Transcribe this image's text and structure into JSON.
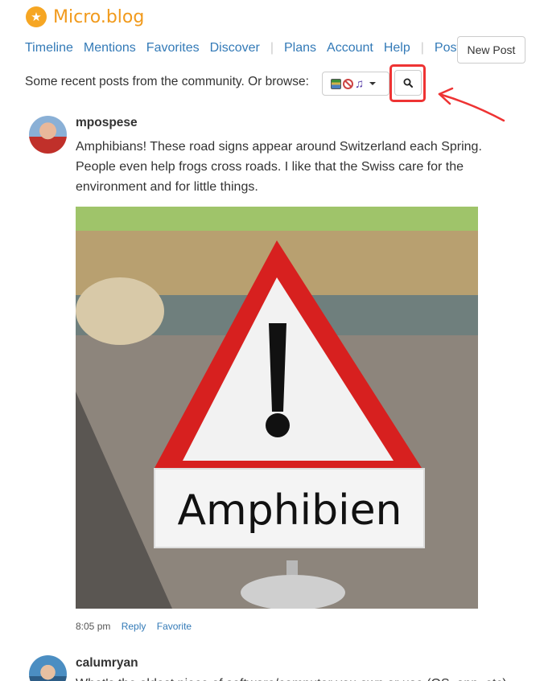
{
  "brand": {
    "name": "Micro.blog",
    "logo_icon": "star-icon",
    "accent": "#f19a1c"
  },
  "nav": {
    "items": [
      "Timeline",
      "Mentions",
      "Favorites",
      "Discover"
    ],
    "items_right": [
      "Plans",
      "Account",
      "Help"
    ],
    "items_last": [
      "Posts"
    ],
    "new_post_label": "New Post"
  },
  "browse": {
    "text": "Some recent posts from the community. Or browse:",
    "dropdown_icons": [
      "books-icon",
      "no-entry-icon",
      "music-note-icon"
    ],
    "search_icon": "search-icon",
    "highlight_color": "#e33333"
  },
  "posts": [
    {
      "author": "mpospese",
      "text": "Amphibians! These road signs appear around Switzerland each Spring. People even help frogs cross roads. I like that the Swiss care for the environment and for little things.",
      "image_sign_text": "Amphibien",
      "time": "8:05 pm",
      "reply_label": "Reply",
      "favorite_label": "Favorite"
    },
    {
      "author": "calumryan",
      "text": "What's the oldest piece of software/computer you own or use (OS, app, etc) still using?"
    }
  ]
}
